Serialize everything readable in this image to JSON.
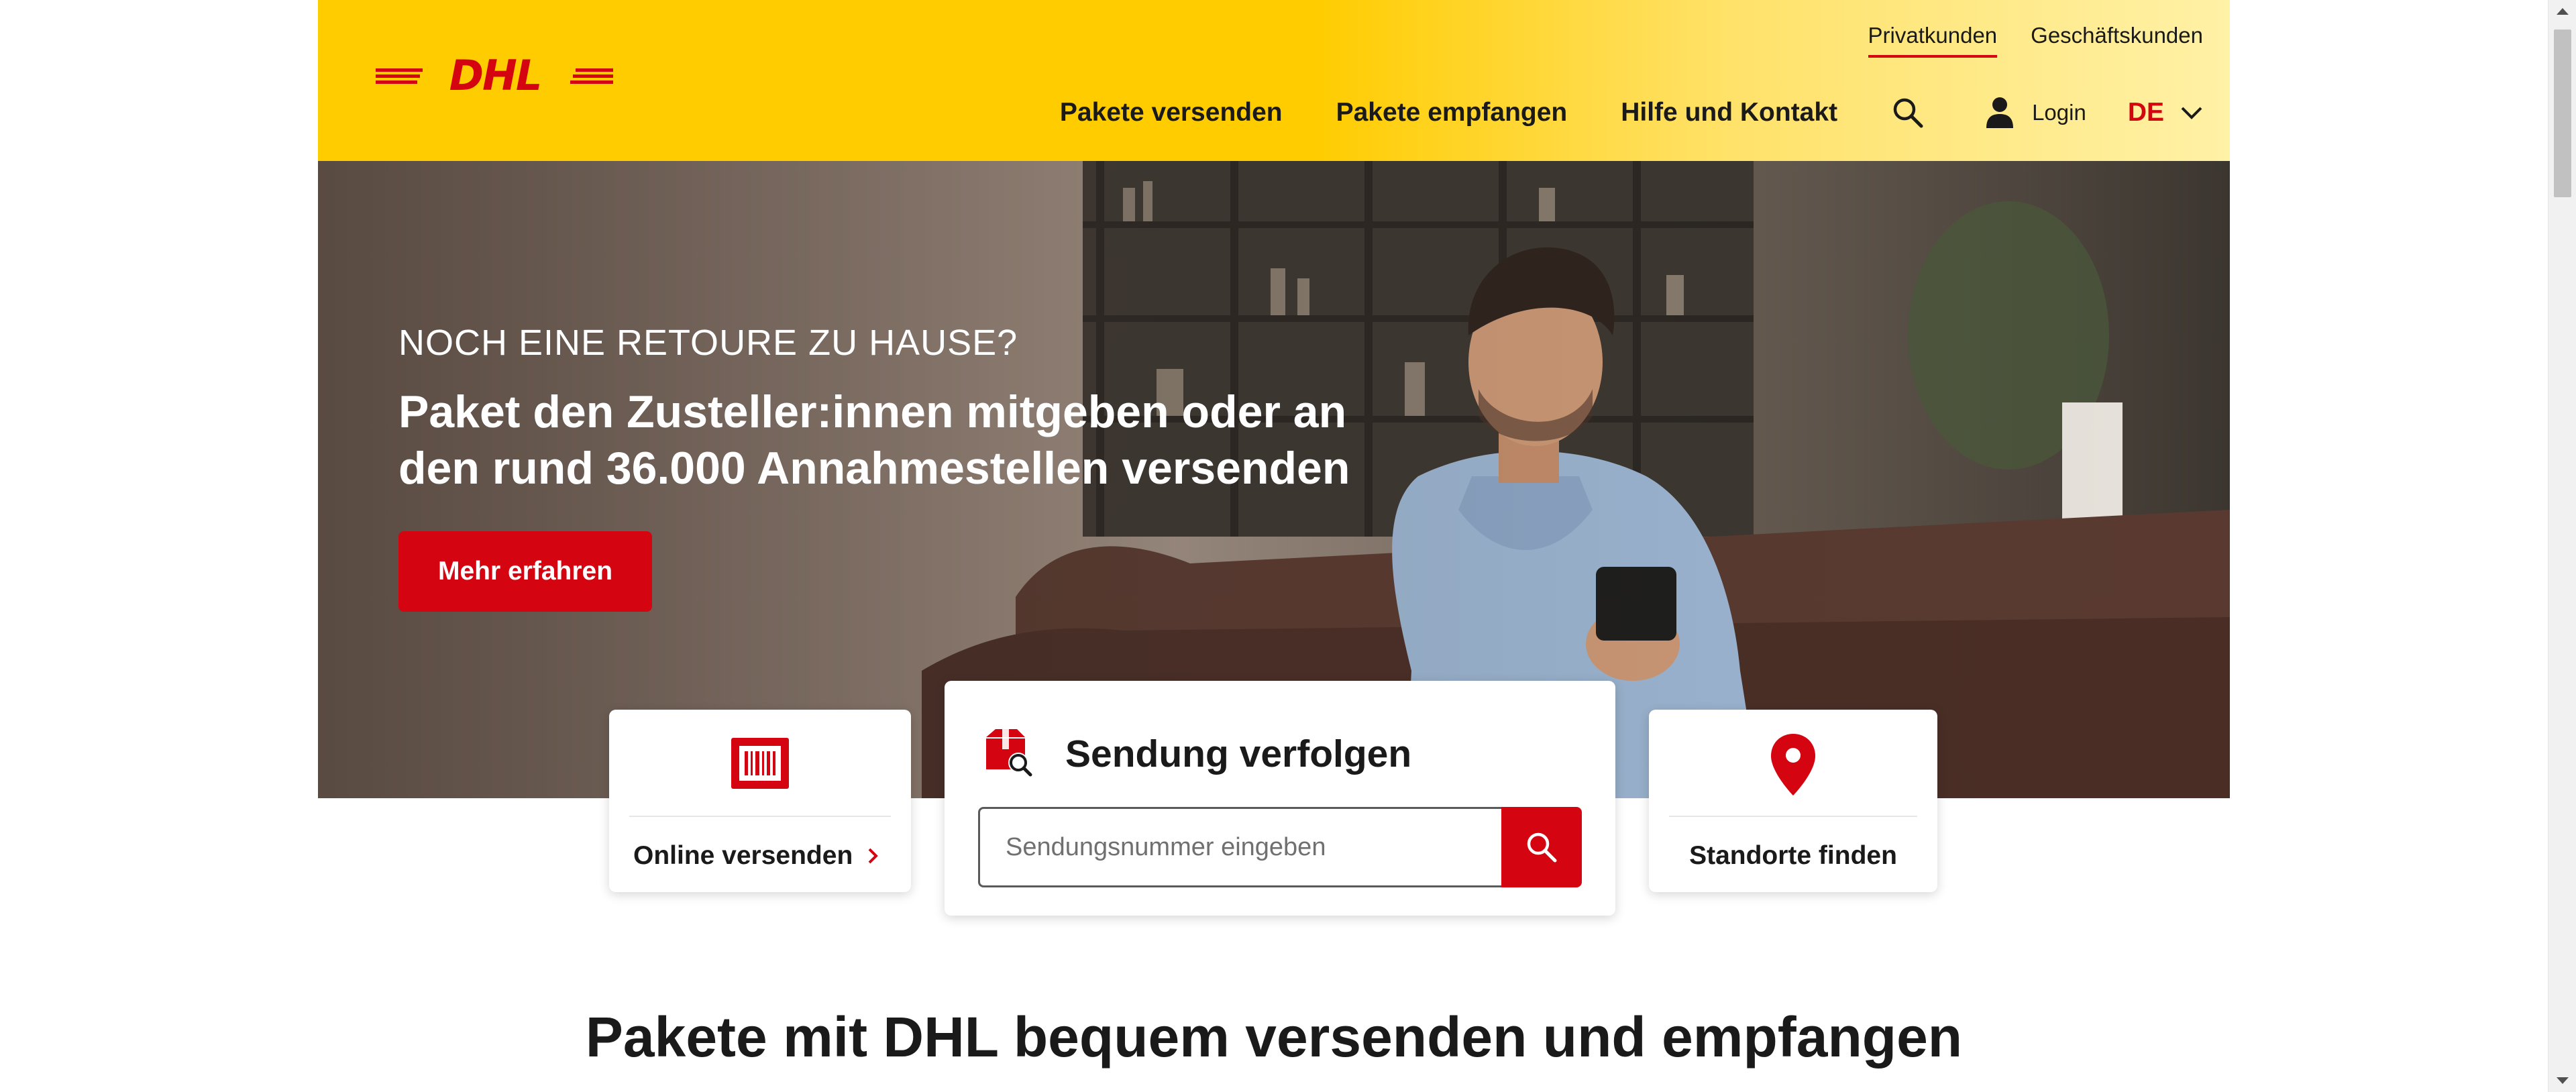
{
  "brand": {
    "logo_text": "DHL",
    "primary_color": "#ffcc00",
    "accent_color": "#d40511"
  },
  "header": {
    "top_links": [
      {
        "label": "Privatkunden",
        "active": true
      },
      {
        "label": "Geschäftskunden",
        "active": false
      }
    ],
    "nav": {
      "send": "Pakete versenden",
      "receive": "Pakete empfangen",
      "help": "Hilfe und Kontakt",
      "search_icon": "search-icon",
      "login": "Login",
      "login_icon": "user-icon",
      "language": "DE",
      "language_icon": "chevron-down-icon"
    }
  },
  "hero": {
    "eyebrow": "NOCH EINE RETOURE ZU HAUSE?",
    "headline_line1": "Paket den Zusteller:innen mitgeben oder an",
    "headline_line2": "den rund 36.000 Annahmestellen versenden",
    "cta": "Mehr erfahren"
  },
  "cards": {
    "online": {
      "label": "Online versenden",
      "icon": "barcode-label-icon",
      "arrow_icon": "chevron-right-icon"
    },
    "tracking": {
      "title": "Sendung verfolgen",
      "icon": "package-search-icon",
      "placeholder": "Sendungsnummer eingeben",
      "value": "",
      "button_icon": "search-icon"
    },
    "locations": {
      "label": "Standorte finden",
      "icon": "location-pin-icon"
    }
  },
  "section": {
    "title": "Pakete mit DHL bequem versenden und empfangen"
  }
}
